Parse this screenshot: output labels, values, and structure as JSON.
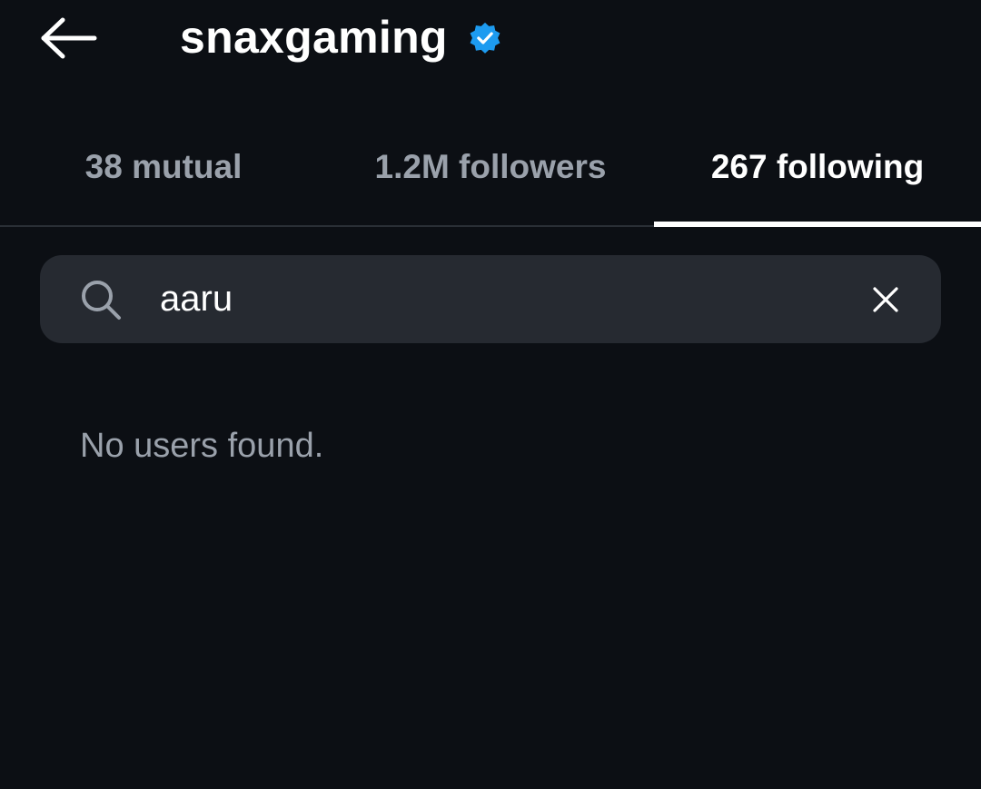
{
  "header": {
    "title": "snaxgaming",
    "verified": true,
    "verified_color": "#1d9bf0",
    "back_icon": "arrow-left-icon"
  },
  "tabs": [
    {
      "label": "38 mutual",
      "active": false
    },
    {
      "label": "1.2M followers",
      "active": false
    },
    {
      "label": "267 following",
      "active": true
    }
  ],
  "search": {
    "value": "aaru",
    "icon": "search-icon",
    "clear_icon": "close-icon"
  },
  "results": {
    "empty_message": "No users found."
  },
  "colors": {
    "background": "#0c0f14",
    "search_background": "#262a31",
    "muted_text": "#9aa1ab",
    "active_text": "#ffffff"
  }
}
